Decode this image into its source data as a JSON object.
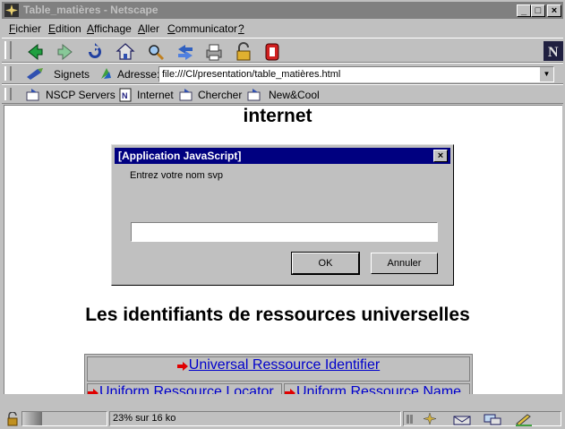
{
  "window": {
    "title": "Table_matières - Netscape"
  },
  "menu": [
    {
      "label": "Fichier",
      "accel": "F"
    },
    {
      "label": "Edition",
      "accel": "E"
    },
    {
      "label": "Affichage",
      "accel": "A"
    },
    {
      "label": "Aller",
      "accel": "A"
    },
    {
      "label": "Communicator",
      "accel": "C"
    },
    {
      "label": "?",
      "accel": "?"
    }
  ],
  "location": {
    "bookmarks_label": "Signets",
    "address_label": "Adresse:",
    "url": "file:///Cl/presentation/table_matières.html"
  },
  "personal_toolbar": [
    {
      "label": "NSCP Servers",
      "icon": "folder-icon"
    },
    {
      "label": "Internet",
      "icon": "page-icon"
    },
    {
      "label": "Chercher",
      "icon": "folder-icon"
    },
    {
      "label": "New&Cool",
      "icon": "folder-icon"
    }
  ],
  "page": {
    "heading_top": "internet",
    "heading_uri": "Les identifiants de ressources universelles",
    "table": {
      "top_link": "Universal Ressource Identifier",
      "left_link": "Uniform Ressource Locator",
      "right_link": "Uniform Ressource Name"
    }
  },
  "dialog": {
    "title": "[Application JavaScript]",
    "prompt": "Entrez votre nom svp",
    "input_value": "",
    "ok_label": "OK",
    "cancel_label": "Annuler"
  },
  "status": {
    "text": "23% sur 16 ko",
    "progress": 0.23
  },
  "colors": {
    "link": "#0000cc",
    "arrow": "#e00000",
    "dialog_title": "#000080"
  }
}
